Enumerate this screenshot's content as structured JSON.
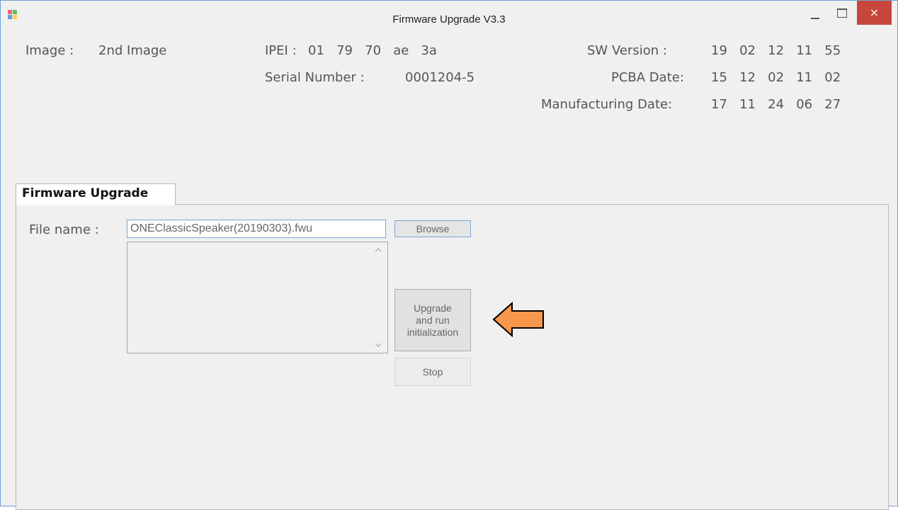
{
  "window": {
    "title": "Firmware Upgrade V3.3",
    "close_label": "×"
  },
  "device_info": {
    "image_label": "Image :",
    "image_value": "2nd Image",
    "ipei_label": "IPEI :",
    "ipei_value": "01   79   70   ae   3a",
    "serial_label": "Serial Number :",
    "serial_value": "0001204-5",
    "sw_version_label": "SW Version :",
    "sw_version_value": "19   02   12   11   55",
    "pcba_date_label": "PCBA Date:",
    "pcba_date_value": "15   12   02   11   02",
    "mfg_date_label": "Manufacturing Date:",
    "mfg_date_value": "17   11   24   06   27"
  },
  "tab": {
    "label": "Firmware Upgrade"
  },
  "form": {
    "file_label": "File name :",
    "file_value": "ONEClassicSpeaker(20190303).fwu",
    "browse_label": "Browse",
    "upgrade_line1": "Upgrade",
    "upgrade_line2": "and run",
    "upgrade_line3": "initialization",
    "stop_label": "Stop",
    "scroll_up": "^",
    "scroll_down": "v"
  },
  "colors": {
    "accent": "#f7974b",
    "close": "#c7463c",
    "border_focus": "#7aa7d9"
  },
  "icons": {
    "app": "app-window-icon",
    "arrow": "left-arrow-annotation"
  }
}
